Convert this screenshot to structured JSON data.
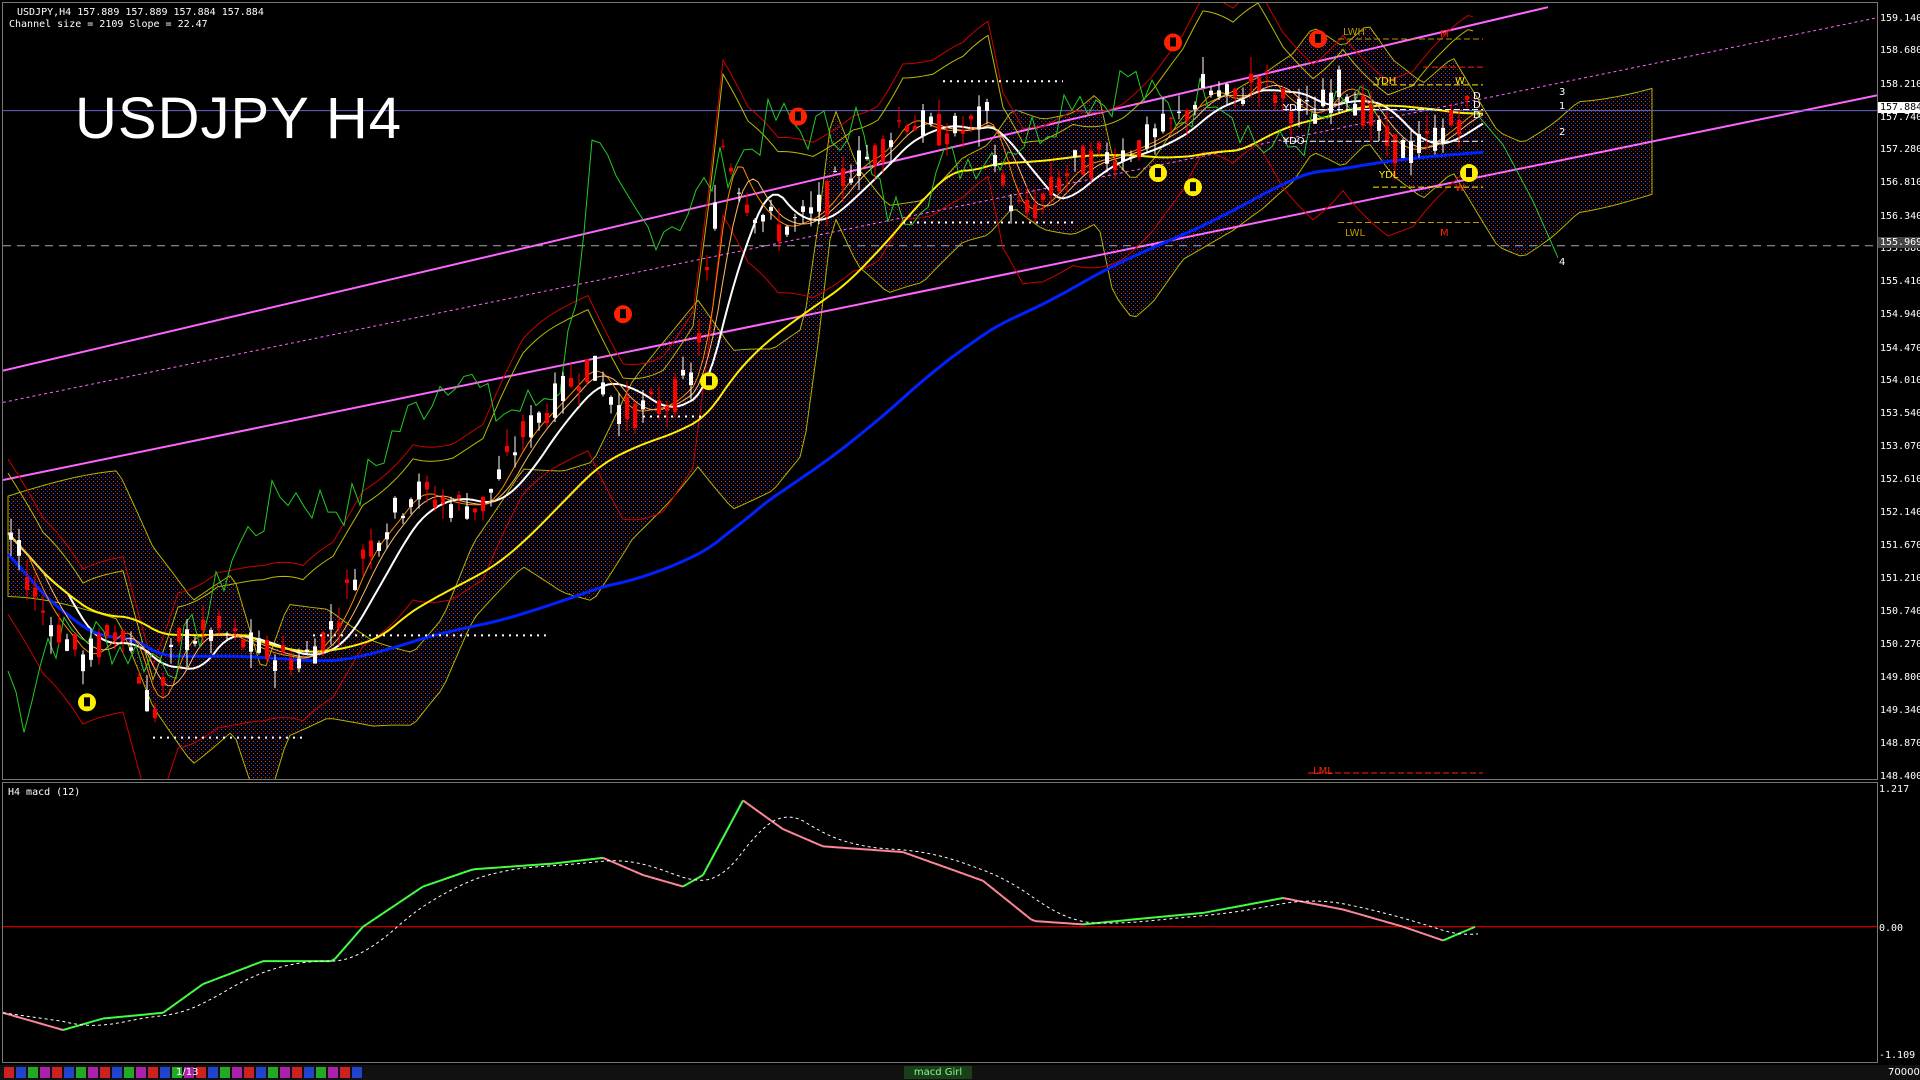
{
  "window": {
    "header_line1": "USDJPY,H4  157.889 157.889 157.884 157.884",
    "header_line2": "Channel size = 2109 Slope = 22.47",
    "title": "USDJPY H4"
  },
  "price_axis": {
    "labels": [
      "159.140",
      "158.680",
      "158.210",
      "157.740",
      "157.280",
      "156.810",
      "156.340",
      "155.880",
      "155.410",
      "154.940",
      "154.470",
      "154.010",
      "153.540",
      "153.070",
      "152.610",
      "152.140",
      "151.670",
      "151.210",
      "150.740",
      "150.270",
      "149.800",
      "149.340",
      "148.870",
      "148.400"
    ],
    "current_price": "157.884",
    "marked_price": "155.969"
  },
  "level_tags": {
    "lwh": "LWH",
    "ydh": "YDH",
    "ydc": "YDC",
    "ydo": "YDO",
    "ydl": "YDL",
    "lwl": "LWL",
    "lml": "LML",
    "m_top": "M",
    "m_low": "M",
    "m_lml": "M",
    "w_top": "W",
    "w_low": "W",
    "d1": "D",
    "d2": "D",
    "d3": "D",
    "fib3": "3",
    "fib1": "1",
    "fib2": "2",
    "fib4": "4"
  },
  "indicator": {
    "label": "H4  macd (12)",
    "axis": {
      "top": "1.217",
      "zero": "0.00",
      "bottom": "-1.109"
    }
  },
  "bottom_bar": {
    "page": "1/13",
    "tab": "macd Girl",
    "volume": "70000"
  },
  "colors": {
    "background": "#000000",
    "bull_candle": "#ffffff",
    "bear_candle": "#ff0000",
    "channel": "#ff66ff",
    "ema_fast": "#ffffff",
    "ema_mid": "#ffee00",
    "ema_slow": "#0022ff",
    "cloud_bear": "#ff3300",
    "cloud_bull": "#2233ff",
    "macd_up": "#44ff44",
    "macd_down": "#ff8899",
    "zero_line": "#ff0000",
    "fib_level": "#b59a00"
  }
}
